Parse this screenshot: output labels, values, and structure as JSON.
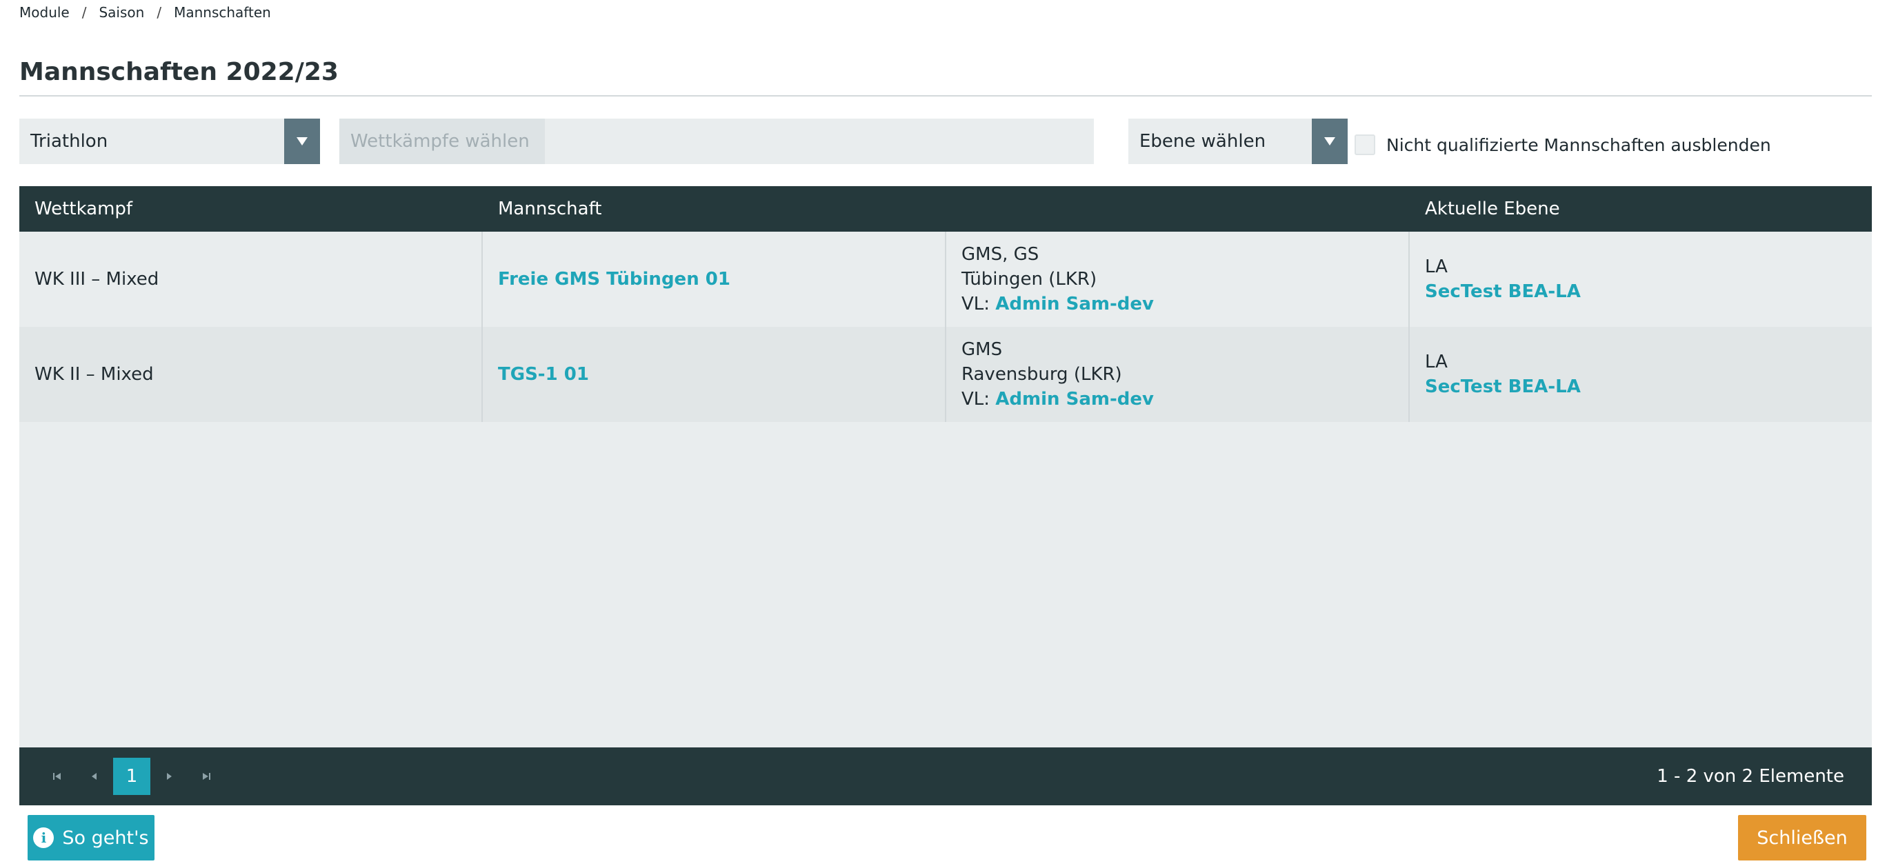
{
  "breadcrumb": {
    "items": [
      "Module",
      "Saison",
      "Mannschaften"
    ],
    "separator": "/"
  },
  "page": {
    "title": "Mannschaften 2022/23"
  },
  "filters": {
    "sport": {
      "value": "Triathlon"
    },
    "competitions": {
      "placeholder": "Wettkämpfe wählen"
    },
    "level": {
      "value": "Ebene wählen"
    },
    "hide_unqualified": {
      "label": "Nicht qualifizierte Mannschaften ausblenden",
      "checked": false
    }
  },
  "table": {
    "headers": [
      "Wettkampf",
      "Mannschaft",
      "",
      "Aktuelle Ebene"
    ],
    "rows": [
      {
        "competition": "WK III – Mixed",
        "team": "Freie GMS Tübingen 01",
        "school_type": "GMS, GS",
        "district": "Tübingen (LKR)",
        "vl_prefix": "VL:",
        "vl_name": "Admin Sam-dev",
        "level": "LA",
        "level_link": "SecTest BEA-LA"
      },
      {
        "competition": "WK II – Mixed",
        "team": "TGS-1 01",
        "school_type": "GMS",
        "district": "Ravensburg (LKR)",
        "vl_prefix": "VL:",
        "vl_name": "Admin Sam-dev",
        "level": "LA",
        "level_link": "SecTest BEA-LA"
      }
    ]
  },
  "pager": {
    "current_page": "1",
    "info": "1 - 2 von 2 Elemente"
  },
  "buttons": {
    "help": "So geht's",
    "help_icon": "info-icon",
    "close": "Schließen"
  },
  "colors": {
    "accent": "#1fa5b8",
    "header_dark": "#25393c",
    "close_orange": "#e5972e"
  }
}
